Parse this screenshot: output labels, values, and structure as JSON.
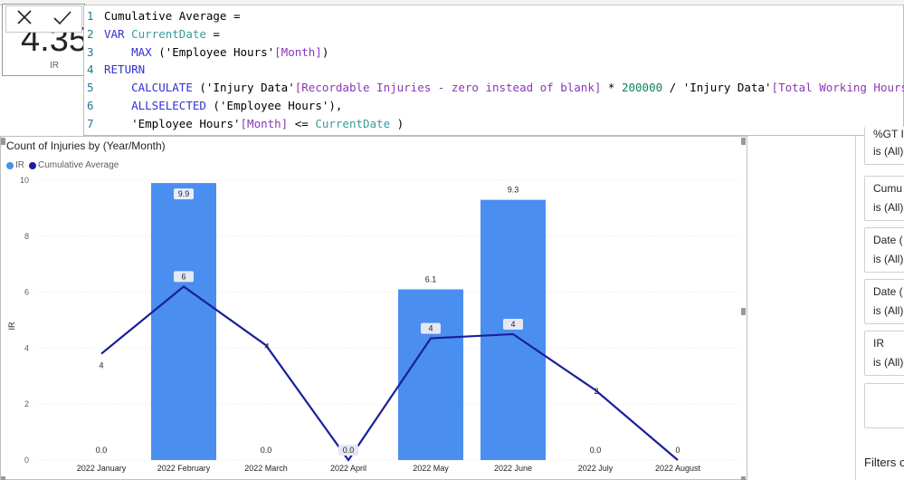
{
  "card": {
    "value": "4.35",
    "label": "IR"
  },
  "editor": {
    "lines": [
      {
        "n": "1",
        "parts": [
          [
            "",
            "Cumulative Average ="
          ]
        ]
      },
      {
        "n": "2",
        "parts": [
          [
            "kw",
            "VAR "
          ],
          [
            "var",
            "CurrentDate"
          ],
          [
            "",
            " ="
          ]
        ]
      },
      {
        "n": "3",
        "parts": [
          [
            "",
            "    "
          ],
          [
            "fn",
            "MAX"
          ],
          [
            "",
            " ('Employee Hours'"
          ],
          [
            "col",
            "[Month]"
          ],
          [
            "",
            ")"
          ]
        ]
      },
      {
        "n": "4",
        "parts": [
          [
            "kw",
            "RETURN"
          ]
        ]
      },
      {
        "n": "5",
        "parts": [
          [
            "",
            "    "
          ],
          [
            "fn",
            "CALCULATE"
          ],
          [
            "",
            " ('Injury Data'"
          ],
          [
            "col",
            "[Recordable Injuries - zero instead of blank]"
          ],
          [
            "",
            " * "
          ],
          [
            "num",
            "200000"
          ],
          [
            "",
            " / 'Injury Data'"
          ],
          [
            "col",
            "[Total Working Hours]"
          ],
          [
            "",
            ","
          ]
        ]
      },
      {
        "n": "6",
        "parts": [
          [
            "",
            "    "
          ],
          [
            "fn",
            "ALLSELECTED"
          ],
          [
            "",
            " ('Employee Hours'),"
          ]
        ]
      },
      {
        "n": "7",
        "parts": [
          [
            "",
            "    'Employee Hours'"
          ],
          [
            "col",
            "[Month]"
          ],
          [
            "",
            " <= "
          ],
          [
            "var",
            "CurrentDate"
          ],
          [
            "",
            " )"
          ]
        ]
      }
    ]
  },
  "colors": {
    "bar": "#4a8ef0",
    "line": "#1a1f9c"
  },
  "chart_data": {
    "type": "bar+line",
    "title": "Count of Injuries by (Year/Month)",
    "ylabel": "IR",
    "ylim": [
      0,
      10
    ],
    "yticks": [
      0,
      2,
      4,
      6,
      8,
      10
    ],
    "grid": true,
    "legend_placement": "top-left",
    "categories": [
      "2022 January",
      "2022 February",
      "2022 March",
      "2022 April",
      "2022 May",
      "2022 June",
      "2022 July",
      "2022 August"
    ],
    "series": [
      {
        "name": "IR",
        "type": "bar",
        "values": [
          0,
          9.9,
          0,
          0,
          6.1,
          9.3,
          0,
          null
        ],
        "labels": [
          "0.0",
          "9.9",
          "0.0",
          "0.0",
          "6.1",
          "9.3",
          "0.0",
          ""
        ]
      },
      {
        "name": "Cumulative Average",
        "type": "line",
        "values": [
          3.8,
          6.2,
          4.1,
          0,
          4.35,
          4.5,
          2.5,
          0
        ],
        "labels": [
          "4",
          "6",
          "4",
          "0.0",
          "4",
          "4",
          "2",
          "0"
        ]
      }
    ]
  },
  "filters": {
    "cards": [
      {
        "title": "%GT I",
        "value": "is (All)"
      },
      {
        "title": "Cumu",
        "value": "is (All)"
      },
      {
        "title": "Date (",
        "value": "is (All)"
      },
      {
        "title": "Date (",
        "value": "is (All)"
      },
      {
        "title": "IR",
        "value": "is (All)"
      }
    ],
    "footer": "Filters o"
  }
}
